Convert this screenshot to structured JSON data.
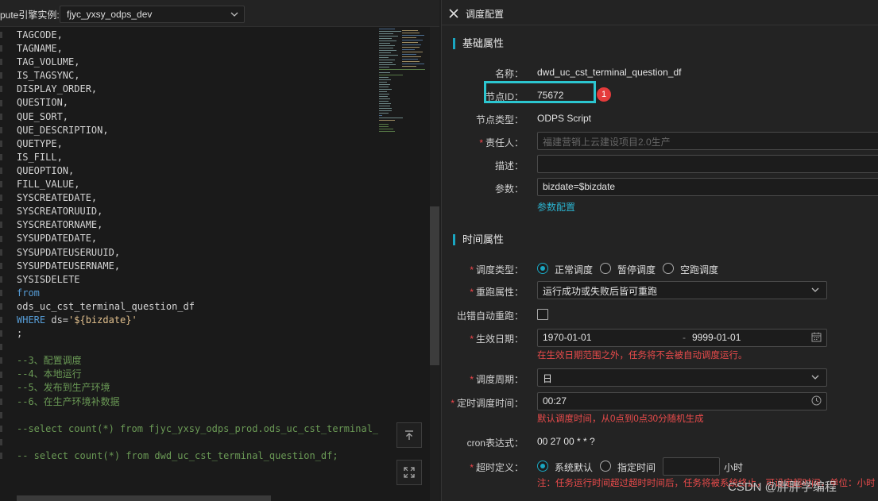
{
  "editor": {
    "engine_label": "pute引擎实例:",
    "engine_value": "fjyc_yxsy_odps_dev",
    "code_lines": [
      {
        "t": "TAGCODE,",
        "c": ""
      },
      {
        "t": "TAGNAME,",
        "c": ""
      },
      {
        "t": "TAG_VOLUME,",
        "c": ""
      },
      {
        "t": "IS_TAGSYNC,",
        "c": ""
      },
      {
        "t": "DISPLAY_ORDER,",
        "c": ""
      },
      {
        "t": "QUESTION,",
        "c": ""
      },
      {
        "t": "QUE_SORT,",
        "c": ""
      },
      {
        "t": "QUE_DESCRIPTION,",
        "c": ""
      },
      {
        "t": "QUETYPE,",
        "c": ""
      },
      {
        "t": "IS_FILL,",
        "c": ""
      },
      {
        "t": "QUEOPTION,",
        "c": ""
      },
      {
        "t": "FILL_VALUE,",
        "c": ""
      },
      {
        "t": "SYSCREATEDATE,",
        "c": ""
      },
      {
        "t": "SYSCREATORUUID,",
        "c": ""
      },
      {
        "t": "SYSCREATORNAME,",
        "c": ""
      },
      {
        "t": "SYSUPDATEDATE,",
        "c": ""
      },
      {
        "t": "SYSUPDATEUSERUUID,",
        "c": ""
      },
      {
        "t": "SYSUPDATEUSERNAME,",
        "c": ""
      },
      {
        "t": "SYSISDELETE",
        "c": ""
      },
      {
        "t": "from",
        "c": "kw"
      },
      {
        "t": "ods_uc_cst_terminal_question_df",
        "c": ""
      },
      {
        "t": "WHERE ds='${bizdate}'",
        "c": "where"
      },
      {
        "t": ";",
        "c": ""
      },
      {
        "t": "",
        "c": ""
      },
      {
        "t": "--3、配置调度",
        "c": "cm"
      },
      {
        "t": "--4、本地运行",
        "c": "cm"
      },
      {
        "t": "--5、发布到生产环境",
        "c": "cm"
      },
      {
        "t": "--6、在生产环境补数据",
        "c": "cm"
      },
      {
        "t": "",
        "c": ""
      },
      {
        "t": "--select count(*) from fjyc_yxsy_odps_prod.ods_uc_cst_terminal_question_df;",
        "c": "cm"
      },
      {
        "t": "",
        "c": ""
      },
      {
        "t": "-- select count(*) from dwd_uc_cst_terminal_question_df;",
        "c": "cm"
      }
    ]
  },
  "panel": {
    "title": "调度配置",
    "basic": {
      "section_title": "基础属性",
      "name_label": "名称：",
      "name_value": "dwd_uc_cst_terminal_question_df",
      "node_id_label": "节点ID：",
      "node_id_value": "75672",
      "badge": "1",
      "node_type_label": "节点类型：",
      "node_type_value": "ODPS Script",
      "owner_label": "责任人：",
      "owner_placeholder": "福建营销上云建设项目2.0生产",
      "desc_label": "描述：",
      "desc_value": "",
      "params_label": "参数：",
      "params_value": "bizdate=$bizdate",
      "params_link": "参数配置"
    },
    "time": {
      "section_title": "时间属性",
      "schedule_type_label": "调度类型：",
      "schedule_type_options": [
        "正常调度",
        "暂停调度",
        "空跑调度"
      ],
      "rerun_label": "重跑属性：",
      "rerun_value": "运行成功或失败后皆可重跑",
      "auto_retry_label": "出错自动重跑：",
      "effective_label": "生效日期：",
      "effective_start": "1970-01-01",
      "effective_sep": "-",
      "effective_end": "9999-01-01",
      "effective_note": "在生效日期范围之外，任务将不会被自动调度运行。",
      "period_label": "调度周期：",
      "period_value": "日",
      "timer_label": "定时调度时间：",
      "timer_value": "00:27",
      "timer_note": "默认调度时间，从0点到0点30分随机生成",
      "cron_label": "cron表达式：",
      "cron_value": "00 27 00 * * ?",
      "timeout_label": "超时定义：",
      "timeout_options": [
        "系统默认",
        "指定时间"
      ],
      "timeout_unit": "小时",
      "timeout_note": "注：任务运行时间超过超时时间后，任务将被系统终止，可设定超时间，单位：小时"
    }
  },
  "watermark": "CSDN @胖胖学编程",
  "colors": {
    "accent": "#1aa6c1",
    "highlight_box": "#2cc6d0",
    "error": "#ea4b4b",
    "badge": "#e43b3b"
  }
}
